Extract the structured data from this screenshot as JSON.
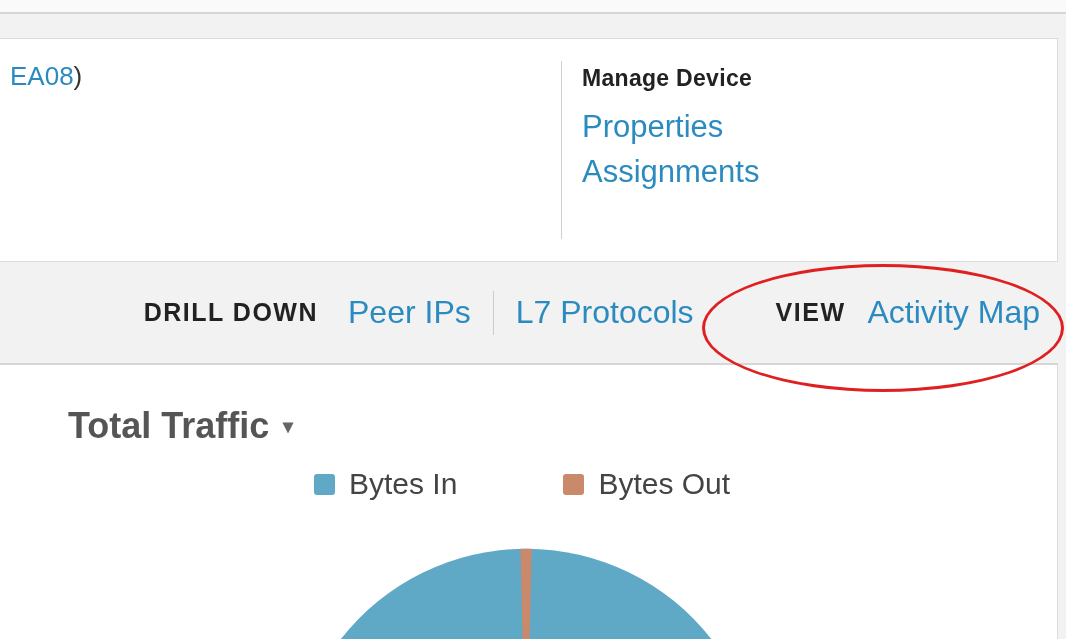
{
  "device_header": {
    "link": "EA08",
    "suffix": ")"
  },
  "manage_device": {
    "title": "Manage Device",
    "links": [
      "Properties",
      "Assignments"
    ]
  },
  "toolbar": {
    "drill_down_label": "DRILL DOWN",
    "drill_down_links": [
      "Peer IPs",
      "L7 Protocols"
    ],
    "view_label": "VIEW",
    "view_link": "Activity Map"
  },
  "chart_panel": {
    "title": "Total Traffic",
    "dropdown": "▾",
    "legend": [
      {
        "label": "Bytes In",
        "color": "#5fa8c6"
      },
      {
        "label": "Bytes Out",
        "color": "#c9896a"
      }
    ]
  }
}
